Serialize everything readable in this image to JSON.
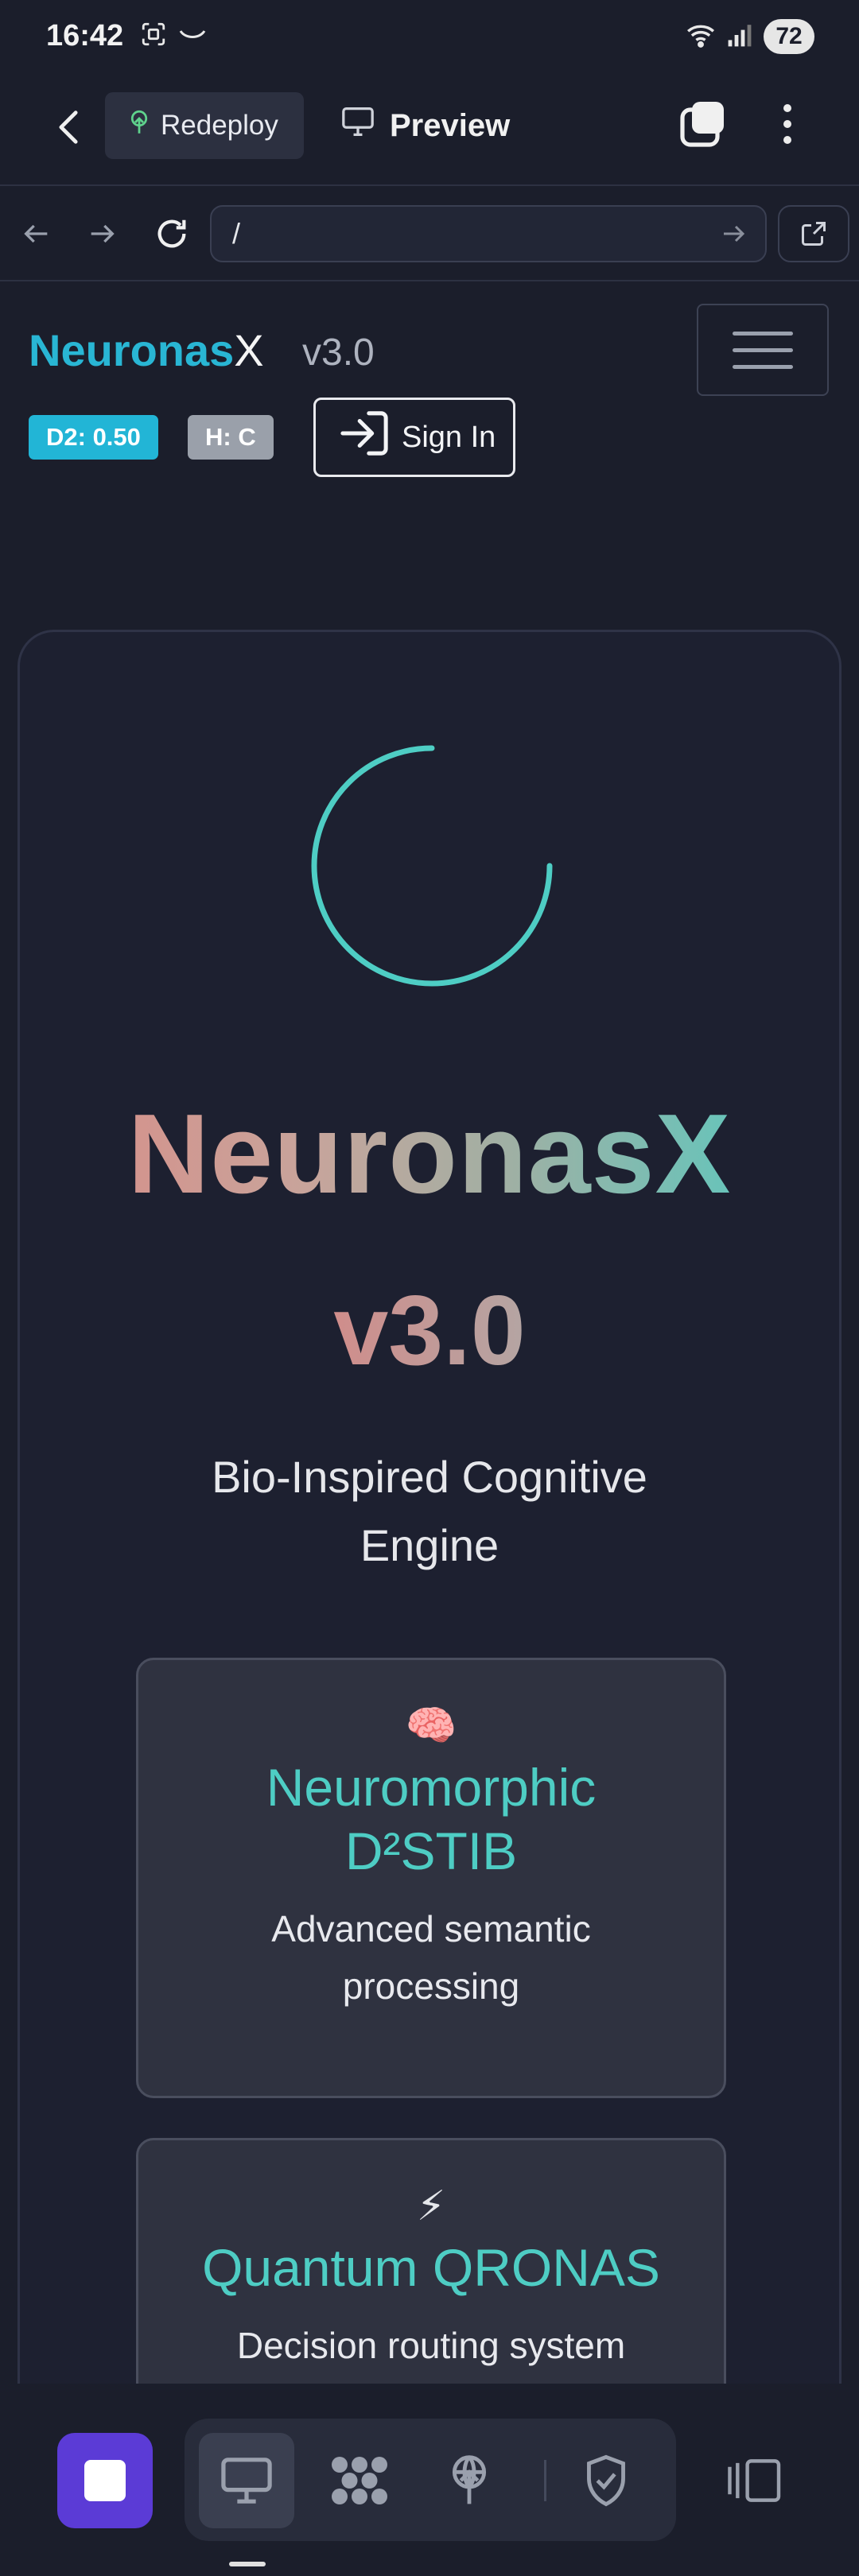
{
  "status_bar": {
    "time": "16:42",
    "battery": "72"
  },
  "app_bar": {
    "redeploy_label": "Redeploy",
    "preview_label": "Preview"
  },
  "browser": {
    "url": "/"
  },
  "site_header": {
    "brand_part1": "Neuronas",
    "brand_part2": "X",
    "version": "v3.0",
    "badge_d2": "D2: 0.50",
    "badge_h": "H: C",
    "sign_in_label": "Sign In"
  },
  "hero": {
    "title": "NeuronasX",
    "version": "v3.0",
    "subtitle": "Bio-Inspired Cognitive Engine",
    "features": [
      {
        "icon": "🧠",
        "title": "Neuromorphic D²STIB",
        "description": "Advanced semantic processing"
      },
      {
        "icon": "⚡",
        "title": "Quantum QRONAS",
        "description": "Decision routing system"
      }
    ]
  },
  "colors": {
    "accent_cyan": "#29b6d4",
    "accent_teal": "#4ecdc4",
    "stop_purple": "#5b3bd6",
    "background": "#1b1e2b"
  }
}
